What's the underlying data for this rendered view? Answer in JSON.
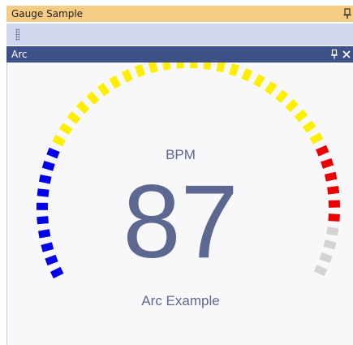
{
  "window": {
    "title": "Gauge Sample",
    "pin_icon": "pin-icon"
  },
  "toolbar": {
    "grip_icon": "grip-icon"
  },
  "panel": {
    "title": "Arc",
    "pin_icon": "pin-icon",
    "close_icon": "close-icon"
  },
  "gauge": {
    "label": "BPM",
    "value": "87",
    "caption": "Arc Example",
    "tick_count": 44,
    "colored_ticks": 40,
    "ranges": [
      {
        "from": 0,
        "to": 10,
        "color": "#0000ee"
      },
      {
        "from": 10,
        "to": 34,
        "color": "#ffee00"
      },
      {
        "from": 34,
        "to": 40,
        "color": "#ee0000"
      }
    ],
    "inactive_color": "#d3d3d3"
  }
}
